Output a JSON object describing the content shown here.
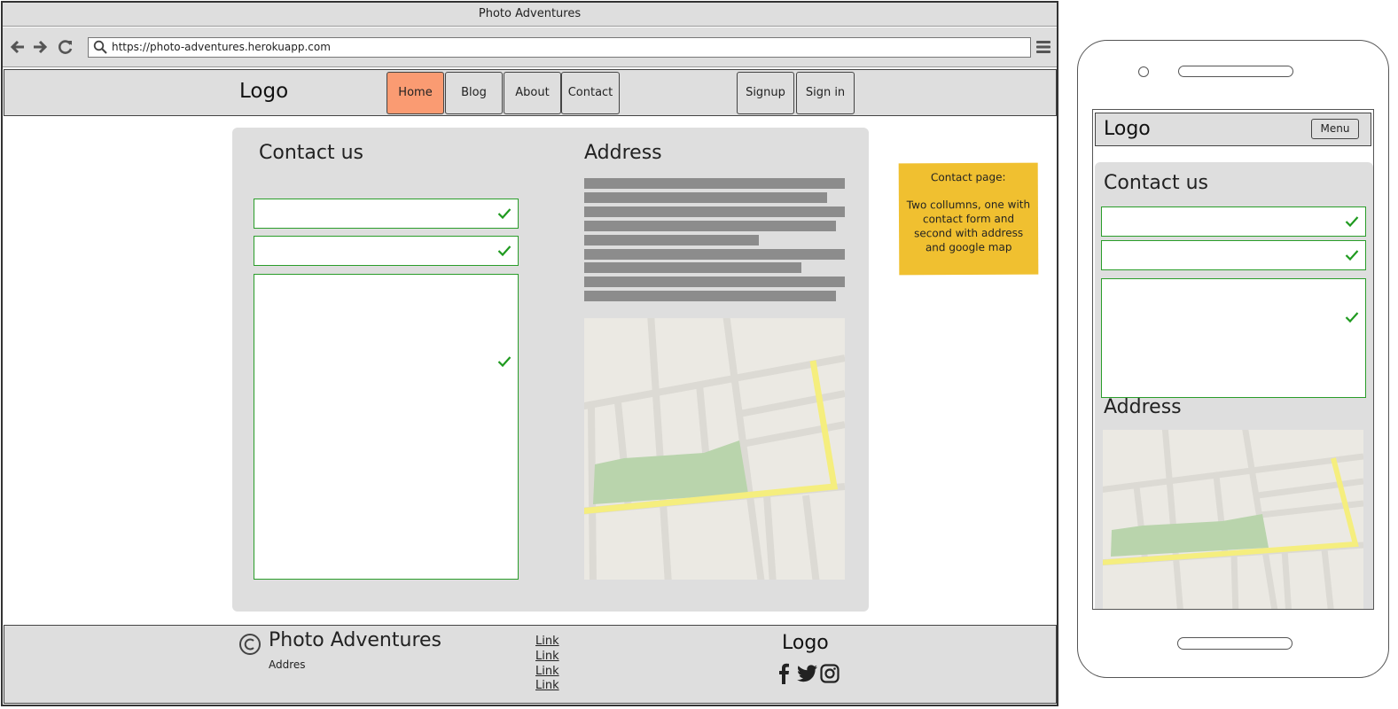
{
  "browser": {
    "window_title": "Photo Adventures",
    "url": "https://photo-adventures.herokuapp.com"
  },
  "site": {
    "logo": "Logo",
    "nav": [
      {
        "label": "Home",
        "active": true
      },
      {
        "label": "Blog",
        "active": false
      },
      {
        "label": "About",
        "active": false
      },
      {
        "label": "Contact",
        "active": false
      }
    ],
    "auth": [
      {
        "label": "Signup"
      },
      {
        "label": "Sign in"
      }
    ]
  },
  "contact": {
    "heading": "Contact us",
    "fields": [
      {
        "type": "text",
        "valid": true
      },
      {
        "type": "text",
        "valid": true
      },
      {
        "type": "textarea",
        "valid": true
      }
    ]
  },
  "address": {
    "heading": "Address"
  },
  "note": {
    "title": "Contact page:",
    "body": "Two collumns, one with contact form and second with address and google map"
  },
  "footer": {
    "brand": "Photo Adventures",
    "address": "Addres",
    "links": [
      "Link",
      "Link",
      "Link",
      "Link"
    ],
    "logo": "Logo",
    "social_icons": [
      "facebook-icon",
      "twitter-icon",
      "instagram-icon"
    ]
  },
  "mobile": {
    "logo": "Logo",
    "menu_label": "Menu",
    "contact_heading": "Contact us",
    "address_heading": "Address"
  },
  "colors": {
    "active_tab": "#fa9b72",
    "valid_border": "#2a9d2a",
    "sticky_note": "#f0c030",
    "panel": "#dedede"
  }
}
